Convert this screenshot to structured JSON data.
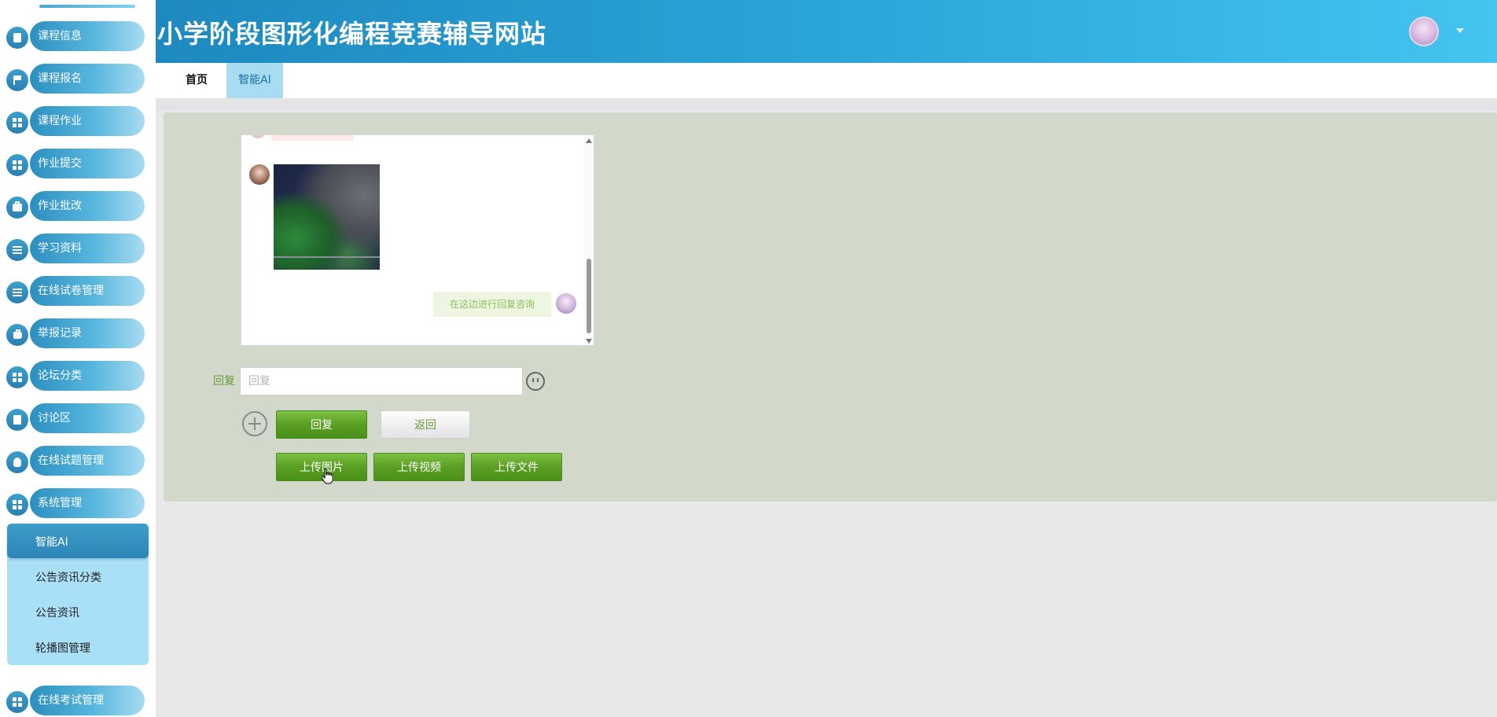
{
  "site": {
    "title": "小学阶段图形化编程竞赛辅导网站"
  },
  "sidebar": {
    "items": [
      {
        "label": "课程信息",
        "icon": "tablet-icon"
      },
      {
        "label": "课程报名",
        "icon": "flag-icon"
      },
      {
        "label": "课程作业",
        "icon": "grid-icon"
      },
      {
        "label": "作业提交",
        "icon": "grid-icon"
      },
      {
        "label": "作业批改",
        "icon": "briefcase-icon"
      },
      {
        "label": "学习资料",
        "icon": "list-icon"
      },
      {
        "label": "在线试卷管理",
        "icon": "list-icon"
      },
      {
        "label": "举报记录",
        "icon": "thumb-icon"
      },
      {
        "label": "论坛分类",
        "icon": "grid-icon"
      },
      {
        "label": "讨论区",
        "icon": "clipboard-icon"
      },
      {
        "label": "在线试题管理",
        "icon": "bulb-icon"
      },
      {
        "label": "系统管理",
        "icon": "grid-icon"
      }
    ],
    "submenu": [
      {
        "label": "智能AI",
        "active": true
      },
      {
        "label": "公告资讯分类",
        "active": false
      },
      {
        "label": "公告资讯",
        "active": false
      },
      {
        "label": "轮播图管理",
        "active": false
      }
    ],
    "last_item": {
      "label": "在线考试管理",
      "icon": "grid-icon"
    }
  },
  "tabs": [
    {
      "label": "首页",
      "active": false
    },
    {
      "label": "智能AI",
      "active": true
    }
  ],
  "chat": {
    "reply_message": "在这边进行回复咨询"
  },
  "form": {
    "reply_label": "回复",
    "reply_placeholder": "回复",
    "reply_value": ""
  },
  "buttons": {
    "reply": "回复",
    "back": "返回",
    "upload_image": "上传图片",
    "upload_video": "上传视频",
    "upload_file": "上传文件"
  },
  "colors": {
    "header_gradient_start": "#1d89bf",
    "header_gradient_end": "#44c4ef",
    "panel_bg": "#d2d9ca",
    "button_green": "#5a9e24",
    "submenu_bg": "#a9dff7"
  }
}
